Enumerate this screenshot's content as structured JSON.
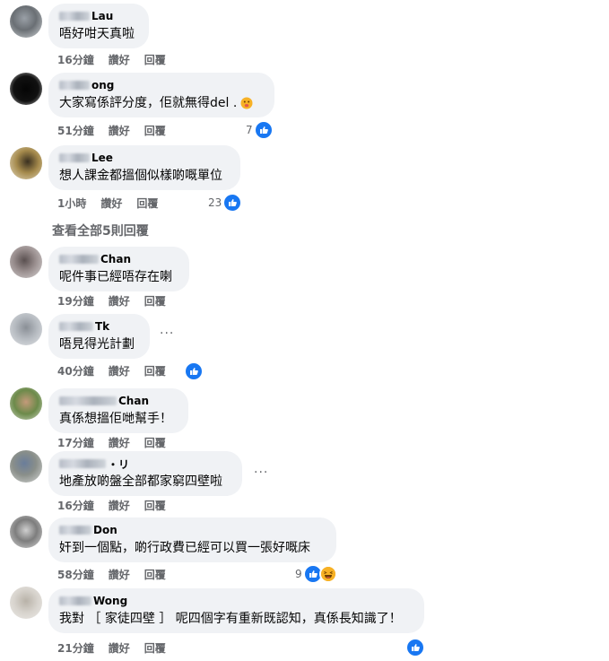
{
  "comments": [
    {
      "name": "Lau",
      "text": "唔好咁天真啦",
      "time": "16分鐘",
      "like": "讚好",
      "reply": "回覆"
    },
    {
      "name": "ong",
      "text": "大家寫係評分度，佢就無得del .",
      "time": "51分鐘",
      "like": "讚好",
      "reply": "回覆",
      "reactions": "7"
    },
    {
      "name": "Lee",
      "text": "想人課金都搵個似樣啲嘅單位",
      "time": "1小時",
      "like": "讚好",
      "reply": "回覆",
      "reactions": "23"
    },
    {
      "name": "Chan",
      "text": "呢件事已經唔存在喇",
      "time": "19分鐘",
      "like": "讚好",
      "reply": "回覆"
    },
    {
      "name": "Tk",
      "text": "唔見得光計劃",
      "time": "40分鐘",
      "like": "讚好",
      "reply": "回覆"
    },
    {
      "name": "Chan",
      "text": "真係想搵佢哋幫手！",
      "time": "17分鐘",
      "like": "讚好",
      "reply": "回覆"
    },
    {
      "name": "・リ",
      "text": "地產放啲盤全部都家窮四壁啦",
      "time": "16分鐘",
      "like": "讚好",
      "reply": "回覆"
    },
    {
      "name": "Don",
      "text": "奸到一個點，啲行政費已經可以買一張好嘅床",
      "time": "58分鐘",
      "like": "讚好",
      "reply": "回覆",
      "reactions": "9"
    },
    {
      "name": "Wong",
      "text": "我對 ［ 家徒四壁 ］ 呢四個字有重新既認知，真係長知識了！",
      "time": "21分鐘",
      "like": "讚好",
      "reply": "回覆"
    }
  ],
  "view_all_replies": "查看全部5則回覆",
  "more_options": "···",
  "colors": {
    "like_blue": "#1877f2",
    "bubble_bg": "#f0f2f5",
    "meta_gray": "#65676b",
    "haha_yellow": "#f7b125"
  }
}
